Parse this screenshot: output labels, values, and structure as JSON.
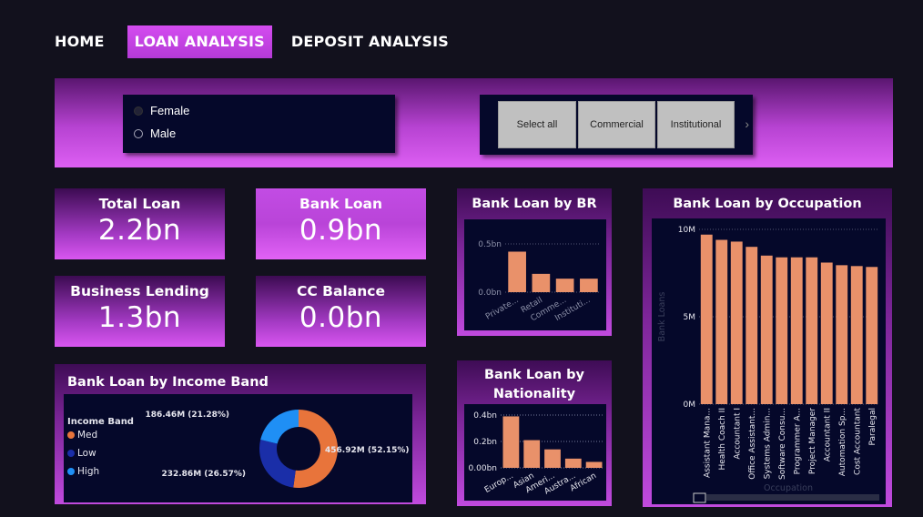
{
  "nav": {
    "tabs": [
      {
        "label": "HOME",
        "active": false
      },
      {
        "label": "LOAN ANALYSIS",
        "active": true
      },
      {
        "label": "DEPOSIT ANALYSIS",
        "active": false
      }
    ]
  },
  "slicers": {
    "gender": {
      "options": [
        "Female",
        "Male"
      ],
      "selected": "Female"
    },
    "tiles": {
      "items": [
        "Select all",
        "Commercial",
        "Institutional"
      ],
      "more_icon": "chevron-right-icon"
    }
  },
  "kpis": [
    {
      "title": "Total Loan",
      "value": "2.2bn"
    },
    {
      "title": "Bank Loan",
      "value": "0.9bn"
    },
    {
      "title": "Business Lending",
      "value": "1.3bn"
    },
    {
      "title": "CC Balance",
      "value": "0.0bn"
    }
  ],
  "colors": {
    "accent": "#d44cf0",
    "bar": "#e9916a",
    "donut_med": "#e8743b",
    "donut_low": "#1a2ea8",
    "donut_high": "#1f8ff5",
    "panel": "#05082a"
  },
  "chart_data": [
    {
      "type": "pie",
      "title": "Bank Loan by Income Band",
      "legend_title": "Income Band",
      "legend_position": "left",
      "categories": [
        "Med",
        "Low",
        "High"
      ],
      "values": [
        456.92,
        232.86,
        186.46
      ],
      "labels": [
        "456.92M (52.15%)",
        "232.86M (26.57%)",
        "186.46M (21.28%)"
      ]
    },
    {
      "type": "bar",
      "title": "Bank Loan by BR",
      "categories": [
        "Private...",
        "Retail",
        "Comme...",
        "Instituti..."
      ],
      "values": [
        0.42,
        0.19,
        0.14,
        0.14
      ],
      "yticks": [
        "0.0bn",
        "0.5bn"
      ],
      "ylim": [
        0,
        0.5
      ],
      "grid": true
    },
    {
      "type": "bar",
      "title": "Bank Loan by Nationality",
      "categories": [
        "Europ...",
        "Asian",
        "Ameri...",
        "Austra...",
        "African"
      ],
      "values": [
        0.39,
        0.21,
        0.14,
        0.07,
        0.045
      ],
      "yticks": [
        "0.00bn",
        "0.2bn",
        "0.4bn"
      ],
      "ylim": [
        0,
        0.4
      ],
      "grid": true
    },
    {
      "type": "bar",
      "title": "Bank Loan by Occupation",
      "xlabel": "Occupation",
      "ylabel": "Bank Loans",
      "categories": [
        "Assistant Mana...",
        "Health Coach II",
        "Accountant I",
        "Office Assistant...",
        "Systems Admin...",
        "Software Consu...",
        "Programmer A...",
        "Project Manager",
        "Accountant II",
        "Automation Sp...",
        "Cost Accountant",
        "Paralegal"
      ],
      "values": [
        9.7,
        9.4,
        9.3,
        9.0,
        8.5,
        8.4,
        8.4,
        8.4,
        8.1,
        7.95,
        7.9,
        7.85
      ],
      "yticks": [
        "0M",
        "5M",
        "10M"
      ],
      "ylim": [
        0,
        10
      ],
      "grid": true
    }
  ]
}
